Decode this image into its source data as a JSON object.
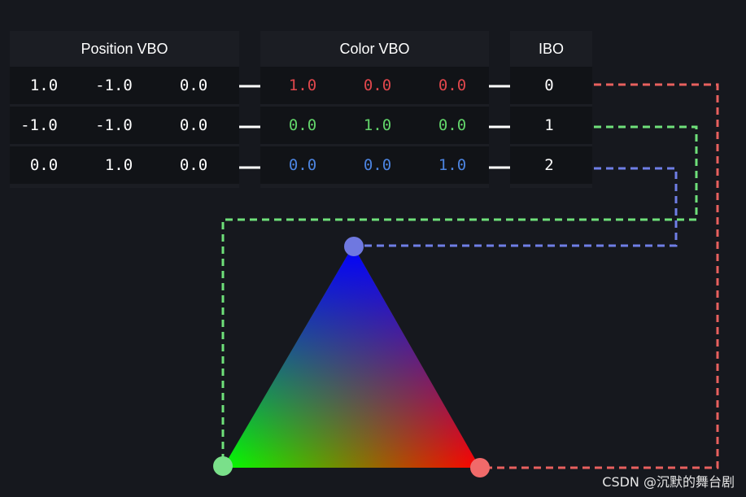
{
  "panels": {
    "position": {
      "title": "Position VBO",
      "rows": [
        [
          "1.0",
          "-1.0",
          "0.0"
        ],
        [
          "-1.0",
          "-1.0",
          "0.0"
        ],
        [
          "0.0",
          "1.0",
          "0.0"
        ]
      ]
    },
    "color": {
      "title": "Color VBO",
      "rows": [
        [
          "1.0",
          "0.0",
          "0.0"
        ],
        [
          "0.0",
          "1.0",
          "0.0"
        ],
        [
          "0.0",
          "0.0",
          "1.0"
        ]
      ]
    },
    "ibo": {
      "title": "IBO",
      "rows": [
        "0",
        "1",
        "2"
      ]
    }
  },
  "colors": {
    "background": "#16181e",
    "panel": "#1b1d23",
    "row": "#111317",
    "red_text": "#e0474c",
    "green_text": "#62d46a",
    "blue_text": "#4c84e0",
    "red_line": "#e8605e",
    "green_line": "#6fe07a",
    "blue_line": "#6f7ee6",
    "vertex_red": "#f06a6a",
    "vertex_green": "#7ae08a",
    "vertex_blue": "#6f78e0",
    "tri_red": "#ff0000",
    "tri_green": "#00ff00",
    "tri_blue": "#0000ff"
  },
  "watermark": "CSDN @沉默的舞台剧"
}
